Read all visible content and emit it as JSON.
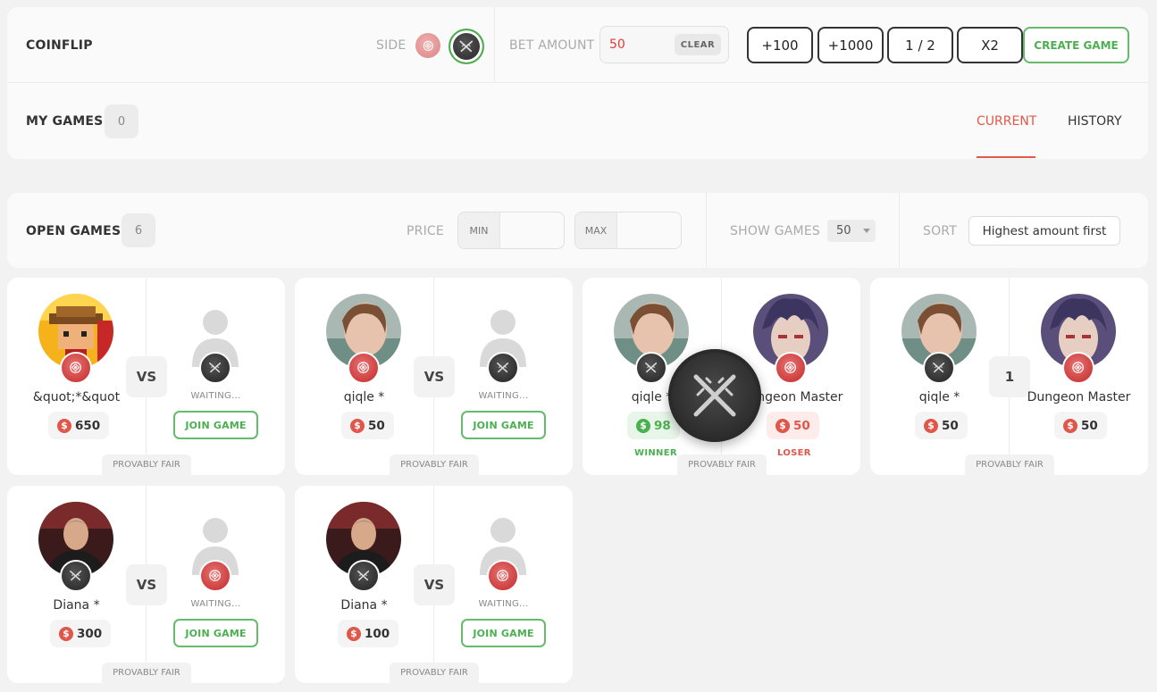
{
  "header": {
    "title": "COINFLIP",
    "side_label": "SIDE",
    "bet_amount_label": "BET AMOUNT",
    "bet_value": "50",
    "clear_label": "CLEAR",
    "quick_buttons": [
      "+100",
      "+1000",
      "1 / 2",
      "X2"
    ],
    "create_label": "CREATE GAME",
    "my_games_label": "MY GAMES",
    "my_games_count": "0",
    "tabs": [
      "CURRENT",
      "HISTORY"
    ]
  },
  "filters": {
    "open_games_label": "OPEN GAMES",
    "open_games_count": "6",
    "price_label": "PRICE",
    "min_label": "MIN",
    "max_label": "MAX",
    "show_games_label": "SHOW GAMES",
    "show_games_value": "50",
    "sort_label": "SORT",
    "sort_value": "Highest amount first"
  },
  "colors": {
    "accent_red": "#e05a47",
    "accent_green": "#4caf50",
    "coin_red": "#d32f2f",
    "coin_dark": "#2a2a2a"
  },
  "games": [
    {
      "p1": "&quot;*&quot",
      "p1_amount": "650",
      "status": "WAITING...",
      "join": "JOIN GAME",
      "vs": "VS",
      "fair": "PROVABLY FAIR"
    },
    {
      "p1": "qiqle *",
      "p1_amount": "50",
      "status": "WAITING...",
      "join": "JOIN GAME",
      "vs": "VS",
      "fair": "PROVABLY FAIR"
    },
    {
      "p1": "qiqle *",
      "p1_amount": "98",
      "p2": "Dungeon Master",
      "p2_amount": "50",
      "winner": "WINNER",
      "loser": "LOSER",
      "fair": "PROVABLY FAIR"
    },
    {
      "p1": "qiqle *",
      "p1_amount": "50",
      "p2": "Dungeon Master",
      "p2_amount": "50",
      "round": "1",
      "fair": "PROVABLY FAIR"
    },
    {
      "p1": "Diana *",
      "p1_amount": "300",
      "status": "WAITING...",
      "join": "JOIN GAME",
      "vs": "VS",
      "fair": "PROVABLY FAIR"
    },
    {
      "p1": "Diana *",
      "p1_amount": "100",
      "status": "WAITING...",
      "join": "JOIN GAME",
      "vs": "VS",
      "fair": "PROVABLY FAIR"
    }
  ],
  "icons": {
    "red_side": "t-side-coin-icon",
    "dark_side": "ct-side-coin-icon",
    "dollar": "dollar-icon"
  }
}
